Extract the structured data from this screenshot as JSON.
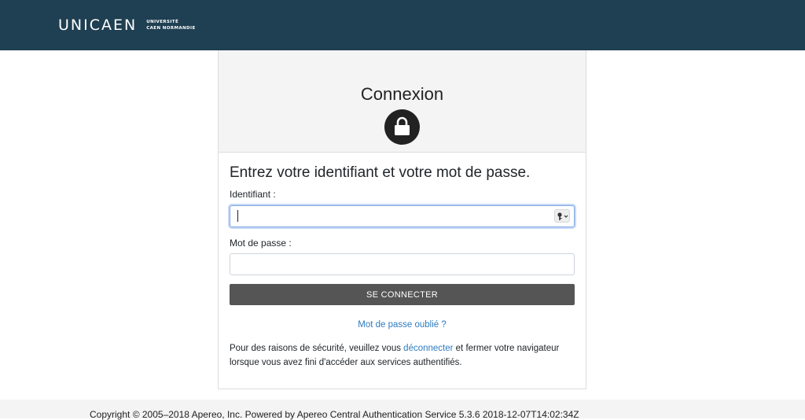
{
  "header": {
    "logo_mark": "UNICAEN",
    "logo_line1": "UNIVERSITÉ",
    "logo_line2": "CAEN NORMANDIE",
    "background": "#1f3f52"
  },
  "card": {
    "title": "Connexion",
    "lock_icon": "lock-icon",
    "instructions": "Entrez votre identifiant et votre mot de passe.",
    "username_label": "Identifiant :",
    "username_value": "",
    "username_placeholder": "",
    "password_label": "Mot de passe :",
    "password_value": "",
    "password_placeholder": "",
    "submit_label": "SE CONNECTER",
    "forgot_label": "Mot de passe oublié ?",
    "security_prefix": "Pour des raisons de sécurité, veuillez vous ",
    "security_link": "déconnecter",
    "security_suffix": " et fermer votre navigateur lorsque vous avez fini d'accéder aux services authentifiés."
  },
  "footer": {
    "prefix": "Copyright © 2005–2018 Apereo, Inc. Powered by ",
    "link": "Apereo Central Authentication Service 5.3.6 2018-12-07T14:02:34Z"
  },
  "colors": {
    "header_bg": "#1f3f52",
    "button_bg": "#555555",
    "link": "#2f7bbf",
    "focus_border": "#80a9e6"
  }
}
